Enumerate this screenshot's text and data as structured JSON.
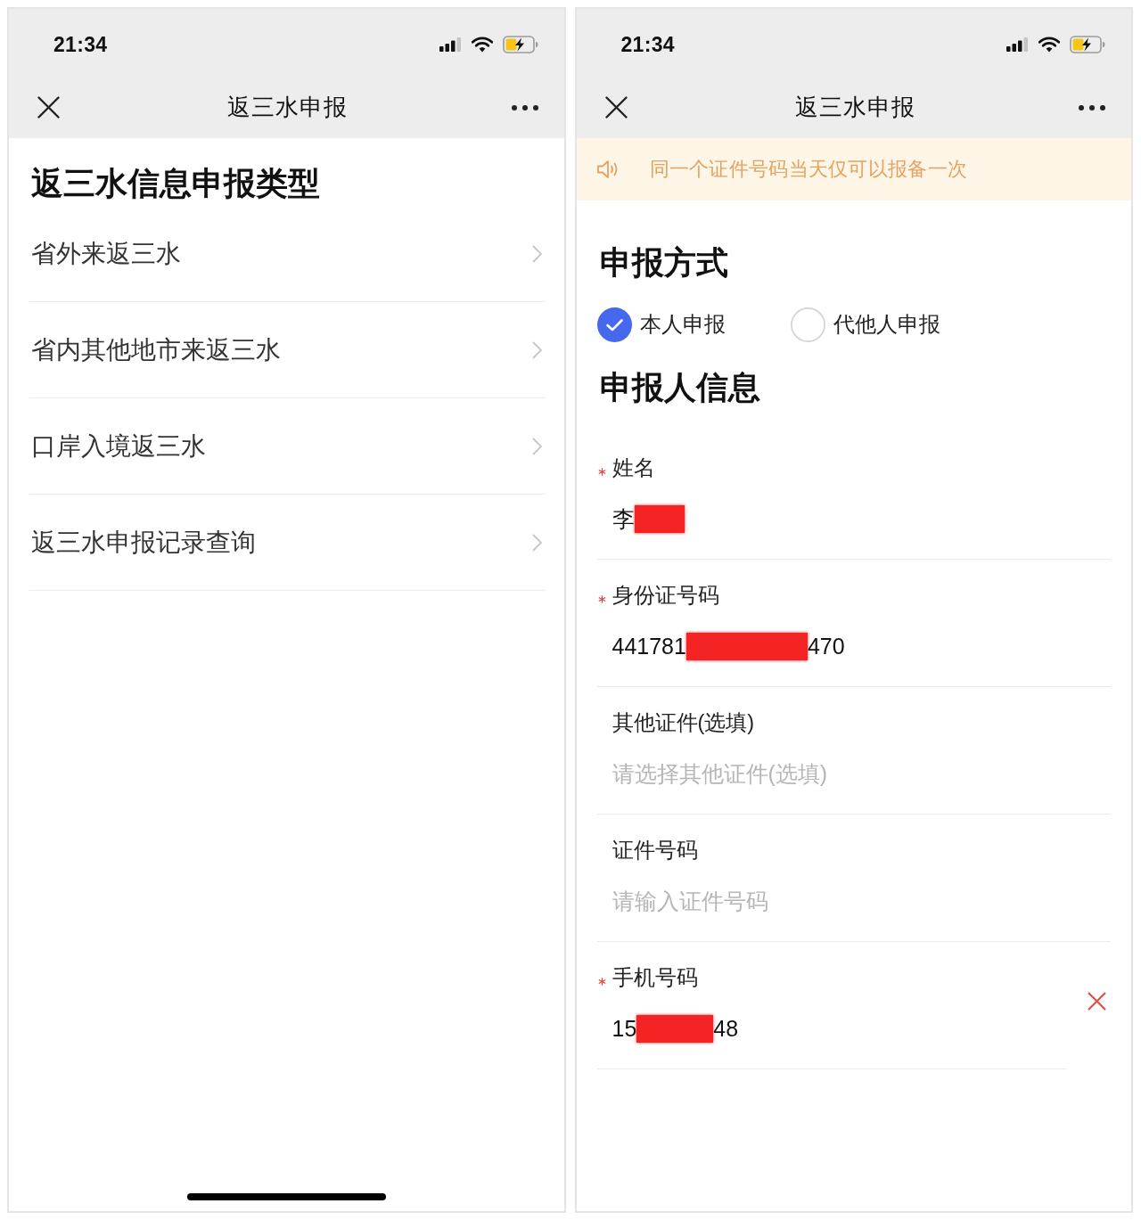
{
  "screens": [
    {
      "kind": "menu",
      "status_bar": {
        "time": "21:34"
      },
      "nav_bar": {
        "title": "返三水申报"
      },
      "heading": "返三水信息申报类型",
      "items": [
        {
          "label": "省外来返三水"
        },
        {
          "label": "省内其他地市来返三水"
        },
        {
          "label": "口岸入境返三水"
        },
        {
          "label": "返三水申报记录查询"
        }
      ],
      "home_indicator": true
    },
    {
      "kind": "form",
      "status_bar": {
        "time": "21:34"
      },
      "nav_bar": {
        "title": "返三水申报"
      },
      "notice": "同一个证件号码当天仅可以报备一次",
      "sections": [
        {
          "kind": "radio",
          "title": "申报方式",
          "options": [
            {
              "label": "本人申报",
              "selected": true
            },
            {
              "label": "代他人申报",
              "selected": false
            }
          ]
        },
        {
          "kind": "fields",
          "title": "申报人信息",
          "fields": [
            {
              "label": "姓名",
              "required": true,
              "clearable": false,
              "value": [
                {
                  "kind": "text",
                  "text": "李"
                },
                {
                  "kind": "redaction"
                }
              ]
            },
            {
              "label": "身份证号码",
              "required": true,
              "clearable": false,
              "value": [
                {
                  "kind": "text",
                  "text": "441781"
                },
                {
                  "kind": "redaction"
                },
                {
                  "kind": "text",
                  "text": "470"
                }
              ]
            },
            {
              "label": "其他证件(选填)",
              "required": false,
              "clearable": false,
              "placeholder": "请选择其他证件(选填)"
            },
            {
              "label": "证件号码",
              "required": false,
              "clearable": false,
              "placeholder": "请输入证件号码"
            },
            {
              "label": "手机号码",
              "required": true,
              "clearable": true,
              "value": [
                {
                  "kind": "text",
                  "text": "15"
                },
                {
                  "kind": "redaction"
                },
                {
                  "kind": "text",
                  "text": "48"
                }
              ]
            }
          ]
        }
      ],
      "home_indicator": false
    }
  ]
}
